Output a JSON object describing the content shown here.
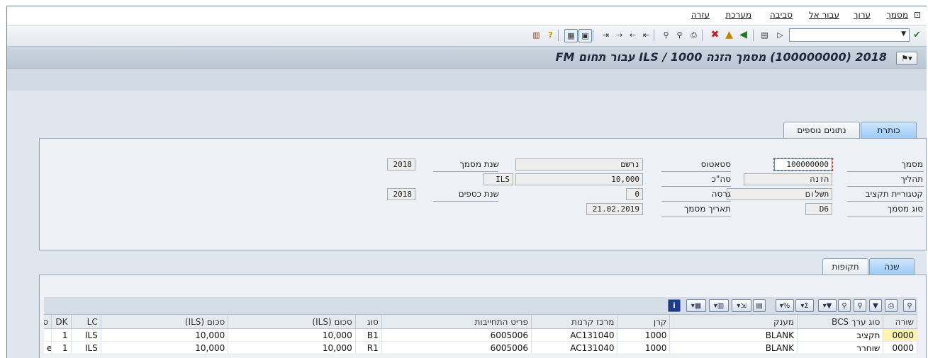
{
  "menu": {
    "items": [
      "מסמך",
      "ערוך",
      "עבור אל",
      "סביבה",
      "מערכת",
      "עזרה"
    ]
  },
  "toolbar": {
    "command_value": "",
    "icons": [
      "check-icon",
      "dropdown-icon",
      "play-icon",
      "save-icon",
      "back-icon",
      "exit-icon",
      "cancel-icon",
      "print-icon",
      "find-icon",
      "find-next-icon",
      "first-page-icon",
      "prev-page-icon",
      "next-page-icon",
      "last-page-icon",
      "create-session-icon",
      "shortcut-icon",
      "help-icon",
      "layout-icon"
    ]
  },
  "title": {
    "text": "2018 (100000000) מסמך הזנה 1000 / ILS עבור תחום FM"
  },
  "header_tabs": [
    {
      "label": "כותרת"
    },
    {
      "label": "נתונים נוספים"
    }
  ],
  "header": {
    "doc_label": "מסמך",
    "doc_value": "100000000",
    "process_label": "תהליך",
    "process_value": "הזנה",
    "budget_cat_label": "קטגוריית תקציב",
    "budget_cat_value": "תשלום",
    "doc_type_label": "סוג מסמך",
    "doc_type_value": "D6",
    "status_label": "סטאטוס",
    "status_value": "נרשם",
    "total_label": "סה\"כ",
    "total_value": "10,000",
    "currency_value": "ILS",
    "version_label": "גרסה",
    "version_value": "0",
    "doc_date_label": "תאריך מסמך",
    "doc_date_value": "21.02.2019",
    "doc_year_label": "שנת מסמך",
    "doc_year_value": "2018",
    "fiscal_year_label": "שנת כספים",
    "fiscal_year_value": "2018"
  },
  "item_tabs": [
    {
      "label": "שנה"
    },
    {
      "label": "תקופות"
    }
  ],
  "grid": {
    "columns": [
      "שורה",
      "סוג ערך BCS",
      "מענק",
      "קרן",
      "מרכז קרנות",
      "פריט התחייבות",
      "סוג",
      "סכום (ILS)",
      "סכום (ILS)",
      "LC",
      "DK",
      "ס"
    ],
    "rows": [
      [
        "0000",
        "תקציב",
        "BLANK",
        "1000",
        "AC131040",
        "6005006",
        "B1",
        "10,000",
        "10,000",
        "ILS",
        "1",
        ""
      ],
      [
        "0000",
        "שוחרר",
        "BLANK",
        "1000",
        "AC131040",
        "6005006",
        "R1",
        "10,000",
        "10,000",
        "ILS",
        "1",
        "e"
      ]
    ]
  }
}
